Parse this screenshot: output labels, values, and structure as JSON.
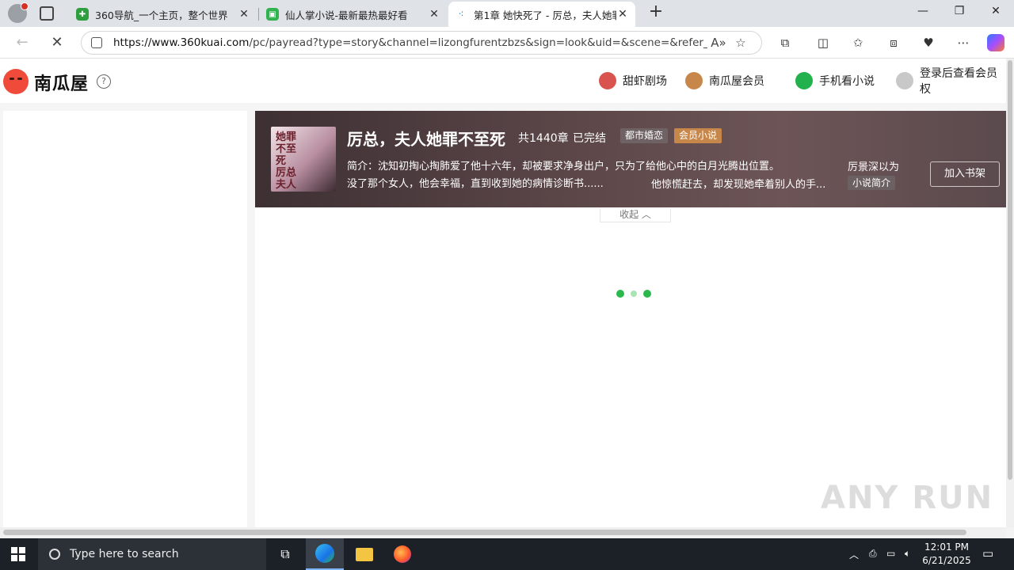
{
  "browser": {
    "tabs": [
      {
        "title": "360导航_一个主页，整个世界",
        "fav_color": "#2f9e3f"
      },
      {
        "title": "仙人掌小说-最新最热最好看",
        "fav_color": "#30b24f"
      },
      {
        "title": "第1章 她快死了 - 厉总，夫人她罪",
        "fav_color": "#1a73e8"
      }
    ],
    "url_host": "https://www.360kuai.com",
    "url_path": "/pc/payread?type=story&channel=lizongfurentzbzs&sign=look&uid=&scene=&refer_sce..."
  },
  "site": {
    "logo": "南瓜屋",
    "nav": [
      {
        "label": "甜虾剧场",
        "color": "#d9534f"
      },
      {
        "label": "南瓜屋会员",
        "color": "#c8874a"
      },
      {
        "label": "手机看小说",
        "color": "#22b14c"
      },
      {
        "label": "登录后查看会员权",
        "color": "#c8c8c8"
      }
    ]
  },
  "book": {
    "cover_text": "她罪不至死 厉总 夫人",
    "title": "厉总，夫人她罪不至死",
    "chapters": "共1440章",
    "status": "已完结",
    "tag_genre": "都市婚恋",
    "tag_member": "会员小说",
    "intro_line1": "简介：沈知初掏心掏肺爱了他十六年，却被要求净身出户，只为了给他心中的白月光腾出位置。",
    "intro_line2": "没了那个女人，他会幸福，直到收到她的病情诊断书......",
    "intro_line3": "他惊慌赶去，却发现她牵着别人的手...",
    "intro_right": "厉景深以为",
    "intro_button": "小说简介",
    "add_shelf": "加入书架",
    "collapse": "收起"
  },
  "watermark": "ANY RUN",
  "taskbar": {
    "search_placeholder": "Type here to search",
    "time": "12:01 PM",
    "date": "6/21/2025"
  }
}
